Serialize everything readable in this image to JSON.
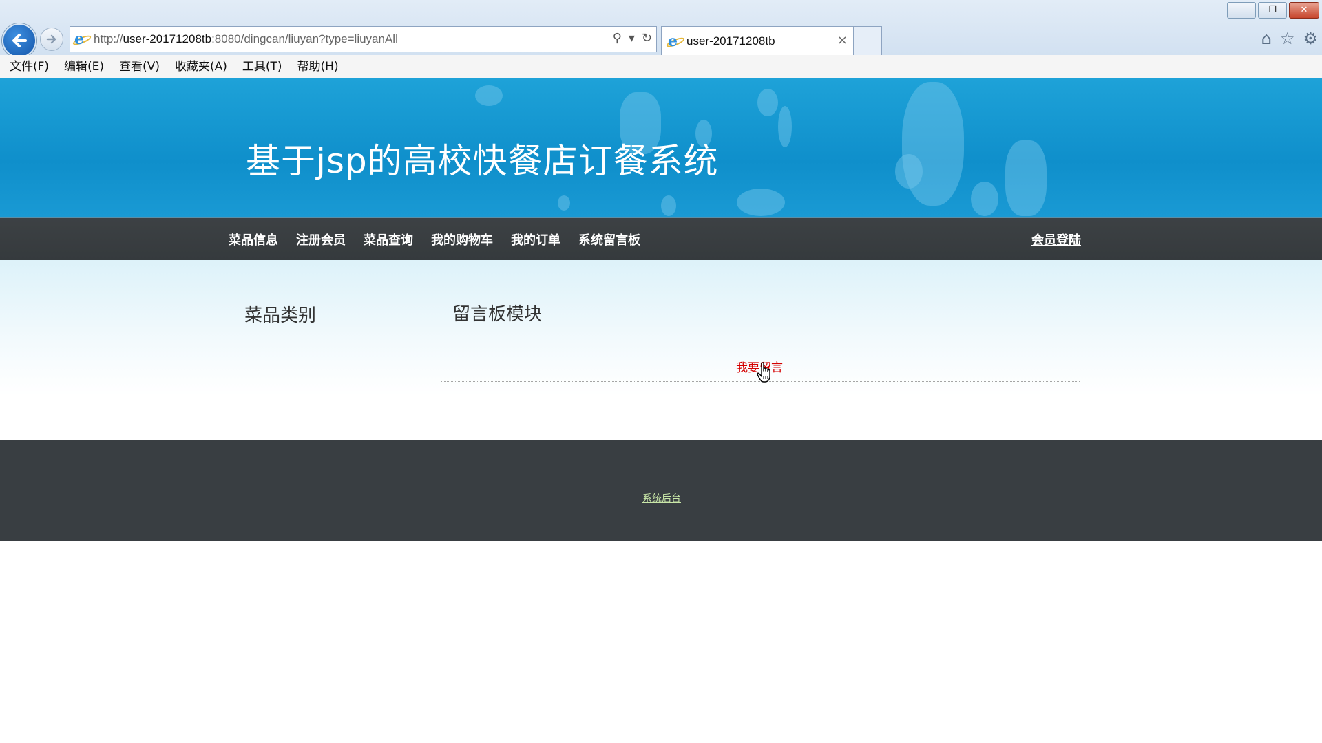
{
  "browser": {
    "url_prefix": "http://",
    "url_host": "user-20171208tb",
    "url_rest": ":8080/dingcan/liuyan?type=liuyanAll",
    "tab_title": "user-20171208tb",
    "tab_close": "×",
    "menu": [
      "文件(F)",
      "编辑(E)",
      "查看(V)",
      "收藏夹(A)",
      "工具(T)",
      "帮助(H)"
    ],
    "window_controls": {
      "minimize": "–",
      "restore": "❐",
      "close": "✕"
    },
    "tools": {
      "search": "⚲",
      "dropdown": "▾",
      "refresh": "↻"
    },
    "right_icons": {
      "home": "⌂",
      "favorites": "☆",
      "settings": "⚙"
    }
  },
  "site": {
    "title": "基于jsp的高校快餐店订餐系统",
    "nav": [
      "菜品信息",
      "注册会员",
      "菜品查询",
      "我的购物车",
      "我的订单",
      "系统留言板"
    ],
    "login": "会员登陆"
  },
  "content": {
    "sidebar_heading": "菜品类别",
    "main_heading": "留言板模块",
    "message_link": "我要留言"
  },
  "footer": {
    "admin_link": "系统后台"
  },
  "colors": {
    "banner": "#1a9ad4",
    "navbar": "#3a3f42",
    "message_link": "#d40000",
    "footer": "#393e42",
    "footer_link": "#c9e7a8"
  }
}
